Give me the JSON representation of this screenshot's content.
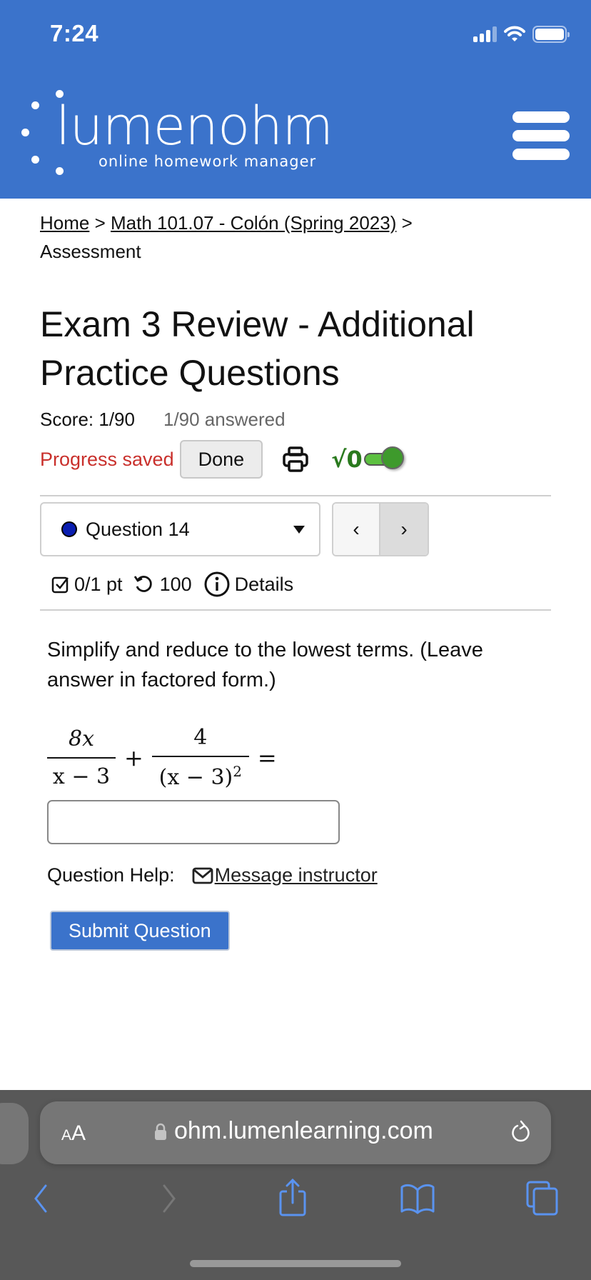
{
  "status_bar": {
    "time": "7:24",
    "icons": [
      "cellular-signal-icon",
      "wifi-icon",
      "battery-icon"
    ]
  },
  "header": {
    "logo_primary": "lumen",
    "logo_secondary": "ohm",
    "logo_tagline": "online homework manager",
    "menu_icon": "hamburger-menu-icon",
    "background_color": "#3b73cb"
  },
  "breadcrumb": {
    "items": [
      {
        "label": "Home",
        "link": true
      },
      {
        "label": "Math 101.07 - Colón (Spring 2023)",
        "link": true
      },
      {
        "label": "Assessment",
        "link": false
      }
    ],
    "separator": ">"
  },
  "assessment": {
    "title": "Exam 3 Review - Additional Practice Questions",
    "score": "Score: 1/90",
    "answered": "1/90 answered",
    "progress_status": "Progress saved",
    "progress_status_color": "#c9302c",
    "done_label": "Done",
    "print_icon": "printer-icon",
    "math_toggle_label": "√0",
    "math_toggle_on": true,
    "toggle_color": "#3e9a2c"
  },
  "question_nav": {
    "selected": "Question 14",
    "status_dot_color": "#0a1eb0",
    "prev_label": "‹",
    "next_label": "›"
  },
  "question_meta": {
    "points": "0/1 pt",
    "attempts": "100",
    "details_label": "Details"
  },
  "question": {
    "text": "Simplify and reduce to the lowest terms. (Leave answer in factored form.)",
    "expression": {
      "term1_numerator": "8x",
      "term1_denominator": "x − 3",
      "operator": "+",
      "term2_numerator": "4",
      "term2_denominator": "(x − 3)",
      "term2_denominator_exponent": "2",
      "equals": "="
    },
    "answer_value": "",
    "help_label": "Question Help:",
    "message_link": "Message instructor",
    "submit_label": "Submit Question",
    "submit_color": "#3b73cb"
  },
  "browser": {
    "text_size_label_small": "A",
    "text_size_label_large": "A",
    "url": "ohm.lumenlearning.com",
    "toolbar": [
      "back-icon",
      "forward-icon",
      "share-icon",
      "bookmarks-icon",
      "tabs-icon"
    ],
    "accent_color": "#5a93f0"
  }
}
